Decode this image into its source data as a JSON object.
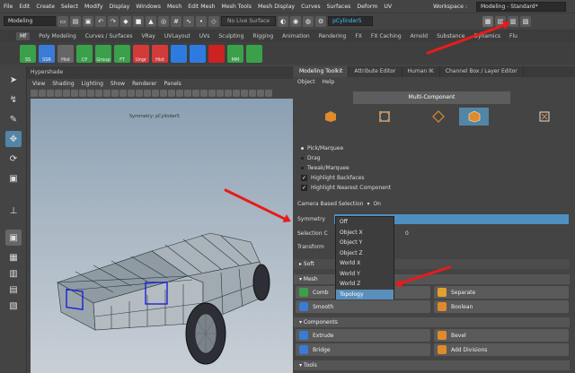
{
  "menubar": [
    "File",
    "Edit",
    "Create",
    "Select",
    "Modify",
    "Display",
    "Windows",
    "Mesh",
    "Edit Mesh",
    "Mesh Tools",
    "Mesh Display",
    "Curves",
    "Surfaces",
    "Deform",
    "UV"
  ],
  "workspace": {
    "label": "Workspace :",
    "value": "Modeling - Standard*"
  },
  "statusline": {
    "mode": "Modeling",
    "live_surface": "No Live Surface",
    "object_field": "pCylinder5"
  },
  "shelf_tabs": [
    "Mf",
    "Poly Modeling",
    "Curves / Surfaces",
    "VRay",
    "UVLayout",
    "UVs",
    "Sculpting",
    "Rigging",
    "Animation",
    "Rendering",
    "FX",
    "FX Caching",
    "Arnold",
    "Substance",
    "Dynamics",
    "Flu"
  ],
  "shelf_icons": [
    {
      "label": "SS",
      "color": "#3aa04a"
    },
    {
      "label": "SSR",
      "color": "#3a7bd5"
    },
    {
      "label": "Hist",
      "color": "#666666"
    },
    {
      "label": "CP",
      "color": "#3aa04a"
    },
    {
      "label": "Group",
      "color": "#3aa04a"
    },
    {
      "label": "FT",
      "color": "#3aa04a"
    },
    {
      "label": "Ungr",
      "color": "#d33b3b"
    },
    {
      "label": "Hist",
      "color": "#d33b3b"
    },
    {
      "label": "",
      "color": "#2d7be0"
    },
    {
      "label": "",
      "color": "#2d7be0"
    },
    {
      "label": "",
      "color": "#cc2222"
    },
    {
      "label": "MM",
      "color": "#3aa04a"
    },
    {
      "label": "",
      "color": "#3aa04a"
    }
  ],
  "viewport": {
    "panel_title": "Hypershade",
    "menu": [
      "View",
      "Shading",
      "Lighting",
      "Show",
      "Renderer",
      "Panels"
    ],
    "object_label": "Symmetry: pCylinder5"
  },
  "toolkit": {
    "tabs": [
      "Modeling Toolkit",
      "Attribute Editor",
      "Human IK",
      "Channel Box / Layer Editor"
    ],
    "submenu": [
      "Object",
      "Help"
    ],
    "multi_component": "Multi-Component",
    "pick_options": [
      "Pick/Marquee",
      "Drag",
      "Tweak/Marquee"
    ],
    "checkboxes": [
      "Highlight Backfaces",
      "Highlight Nearest Component"
    ],
    "camera_label": "Camera Based Selection",
    "camera_value": "On",
    "symmetry_label": "Symmetry",
    "selection_label": "Selection C",
    "selection_value": "0",
    "transform_label": "Transform",
    "soft_label": "Soft",
    "mesh_label": "Mesh",
    "mesh_buttons": [
      "Comb",
      "Separate",
      "Smooth",
      "Boolean"
    ],
    "components_label": "Components",
    "components_buttons": [
      "Extrude",
      "Bevel",
      "Bridge",
      "Add Divisions"
    ],
    "tools_label": "Tools"
  },
  "symmetry_dropdown": [
    "Off",
    "Object X",
    "Object Y",
    "Object Z",
    "World X",
    "World Y",
    "World Z",
    "Topology"
  ],
  "accent": {
    "selection": "#5285a6",
    "highlight": "#5a8fbc",
    "annotation": "#e81b1b"
  }
}
